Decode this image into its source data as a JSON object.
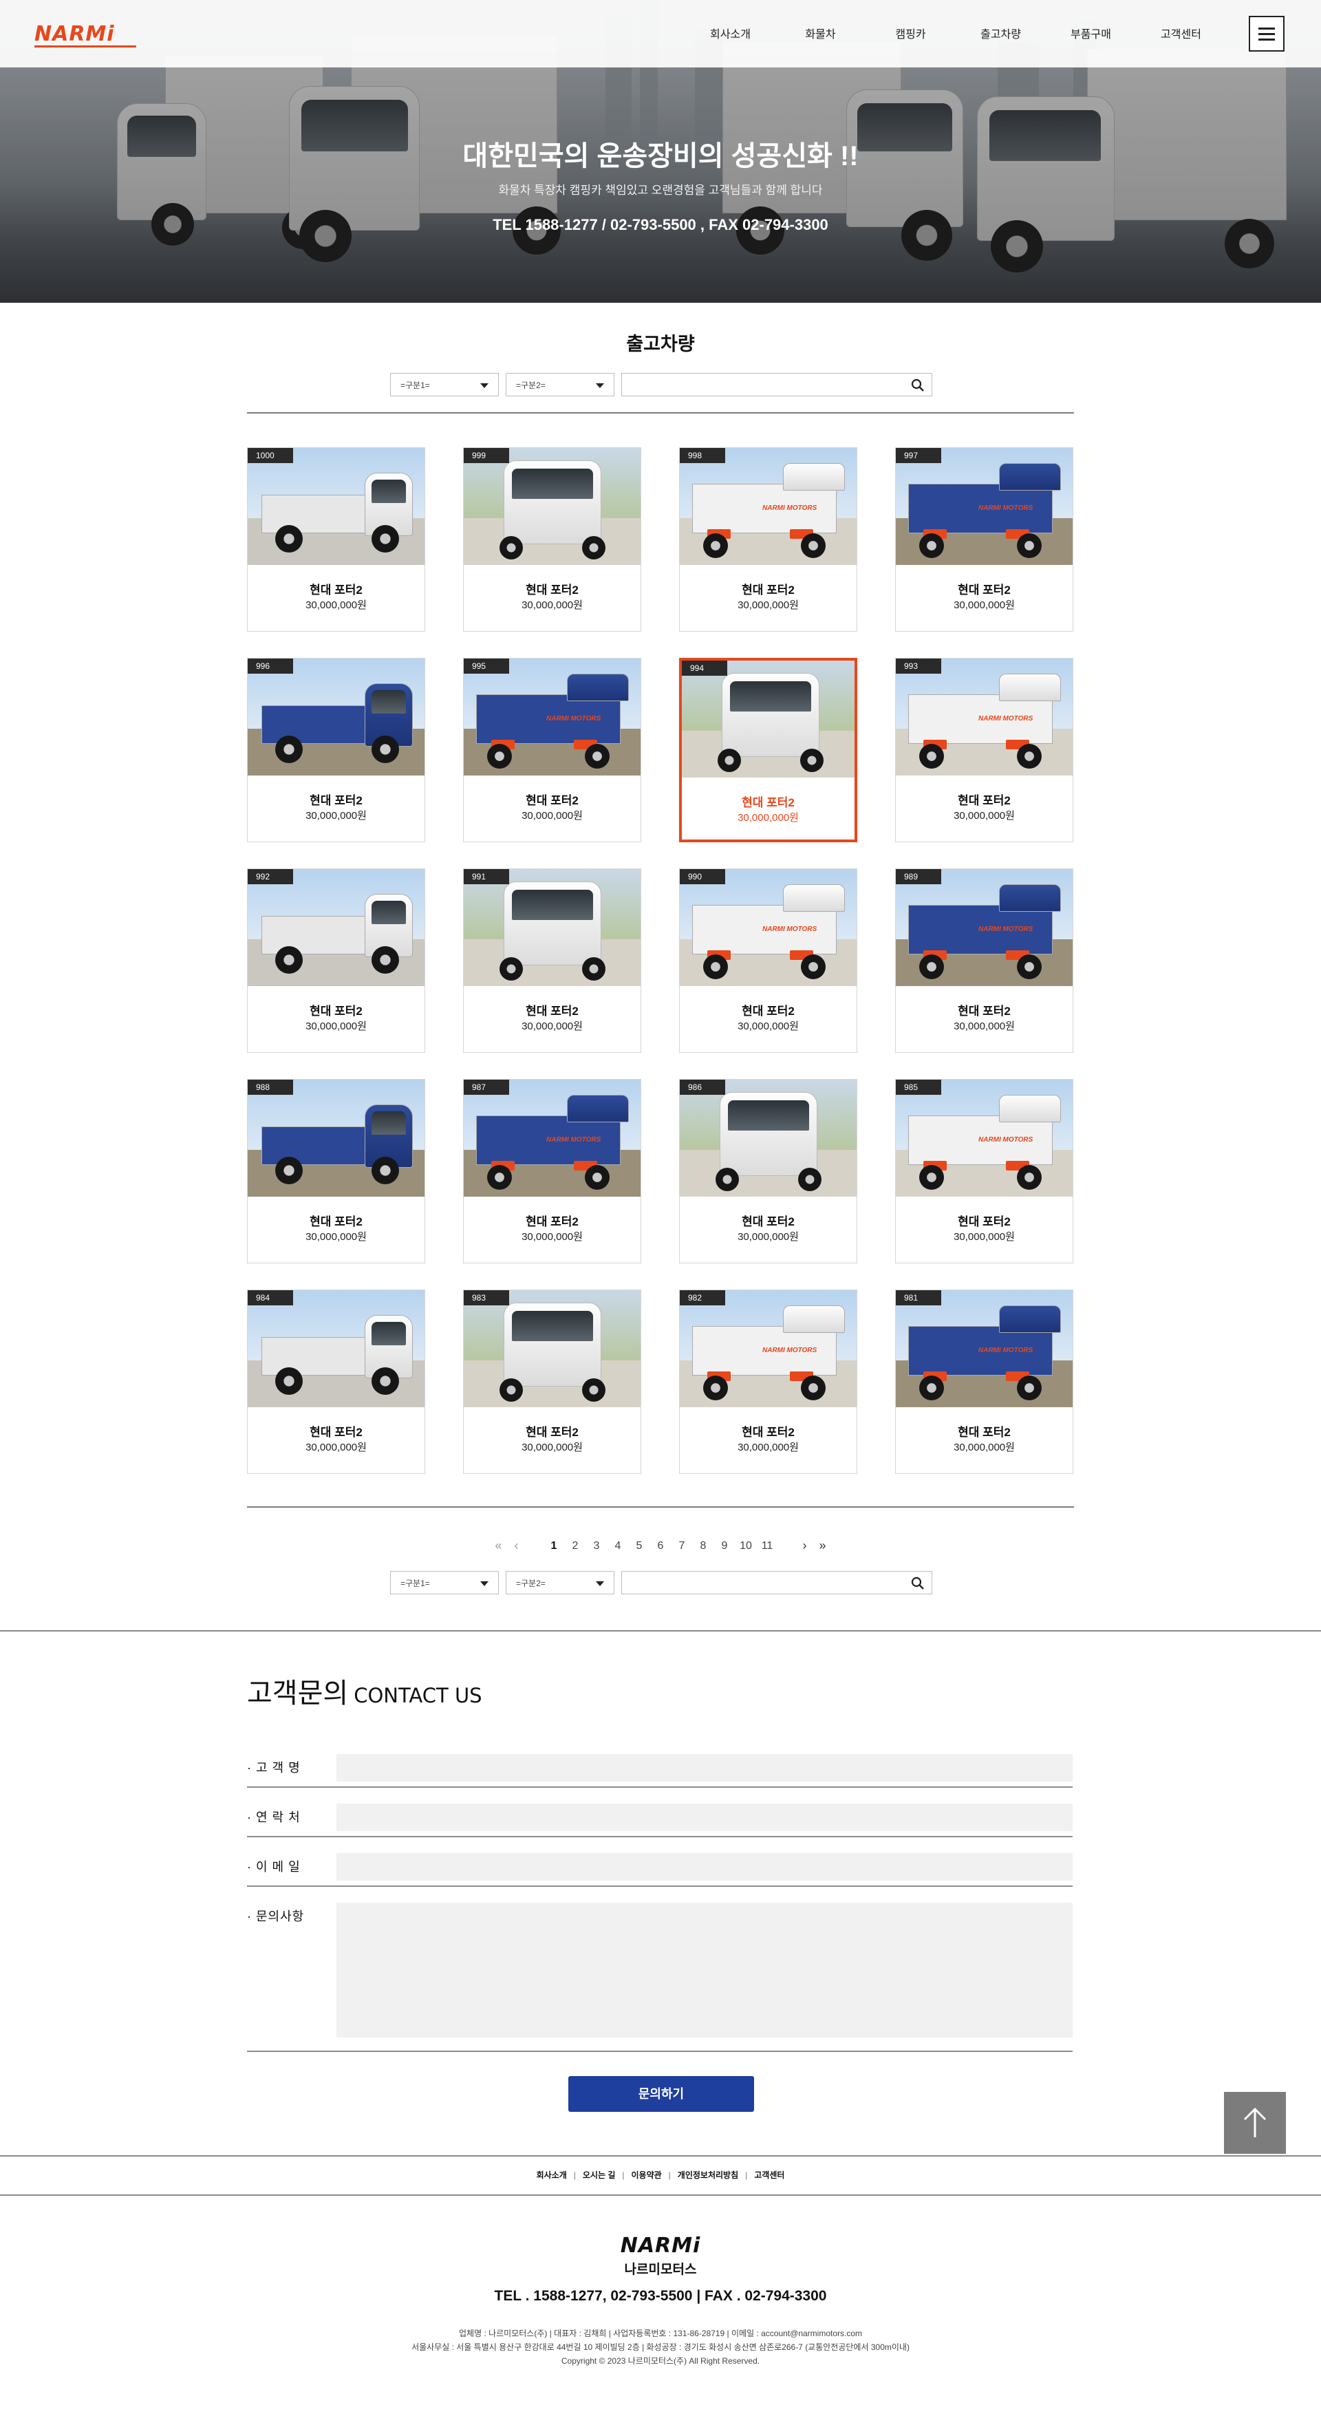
{
  "header": {
    "logo": "NARMi",
    "nav": [
      "회사소개",
      "화물차",
      "캠핑카",
      "출고차량",
      "부품구매",
      "고객센터"
    ]
  },
  "hero": {
    "title": "대한민국의 운송장비의 성공신화 !!",
    "subtitle": "화물차 특장차 캠핑카 책임있고 오랜경험을 고객님들과 함께 합니다",
    "tel": "TEL  1588-1277 / 02-793-5500 , FAX  02-794-3300"
  },
  "section": {
    "title": "출고차량",
    "filter1": "=구분1=",
    "filter2": "=구분2="
  },
  "cards": [
    {
      "no": "1000",
      "name": "현대 포터2",
      "price": "30,000,000원"
    },
    {
      "no": "999",
      "name": "현대 포터2",
      "price": "30,000,000원"
    },
    {
      "no": "998",
      "name": "현대 포터2",
      "price": "30,000,000원"
    },
    {
      "no": "997",
      "name": "현대 포터2",
      "price": "30,000,000원"
    },
    {
      "no": "996",
      "name": "현대 포터2",
      "price": "30,000,000원"
    },
    {
      "no": "995",
      "name": "현대 포터2",
      "price": "30,000,000원"
    },
    {
      "no": "994",
      "name": "현대 포터2",
      "price": "30,000,000원"
    },
    {
      "no": "993",
      "name": "현대 포터2",
      "price": "30,000,000원"
    },
    {
      "no": "992",
      "name": "현대 포터2",
      "price": "30,000,000원"
    },
    {
      "no": "991",
      "name": "현대 포터2",
      "price": "30,000,000원"
    },
    {
      "no": "990",
      "name": "현대 포터2",
      "price": "30,000,000원"
    },
    {
      "no": "989",
      "name": "현대 포터2",
      "price": "30,000,000원"
    },
    {
      "no": "988",
      "name": "현대 포터2",
      "price": "30,000,000원"
    },
    {
      "no": "987",
      "name": "현대 포터2",
      "price": "30,000,000원"
    },
    {
      "no": "986",
      "name": "현대 포터2",
      "price": "30,000,000원"
    },
    {
      "no": "985",
      "name": "현대 포터2",
      "price": "30,000,000원"
    },
    {
      "no": "984",
      "name": "현대 포터2",
      "price": "30,000,000원"
    },
    {
      "no": "983",
      "name": "현대 포터2",
      "price": "30,000,000원"
    },
    {
      "no": "982",
      "name": "현대 포터2",
      "price": "30,000,000원"
    },
    {
      "no": "981",
      "name": "현대 포터2",
      "price": "30,000,000원"
    }
  ],
  "active_card": "994",
  "truck_brand": "NARMI MOTORS",
  "pagination": {
    "first": "«",
    "prev": "‹",
    "pages": [
      "1",
      "2",
      "3",
      "4",
      "5",
      "6",
      "7",
      "8",
      "9",
      "10",
      "11"
    ],
    "current": "1",
    "next": "›",
    "last": "»"
  },
  "contact": {
    "title_ko": "고객문의",
    "title_en": "CONTACT US",
    "fields": [
      "· 고 객 명",
      "· 연 락 처",
      "· 이 메 일",
      "· 문의사항"
    ],
    "submit": "문의하기"
  },
  "footer": {
    "links": [
      "회사소개",
      "오시는 길",
      "이용약관",
      "개인정보처리방침",
      "고객센터"
    ],
    "logo_en": "NARMi",
    "logo_ko": "나르미모터스",
    "tel": "TEL . 1588-1277,  02-793-5500   |   FAX . 02-794-3300",
    "info1": "업체명 : 나르미모터스(주)   |   대표자 : 김채희   |   사업자등록번호 : 131-86-28719   |   이메일 : account@narmimotors.com",
    "info2": "서울사무실 : 서울 특별시 용산구 한강대로 44번길 10 제이빌딩 2층   |   화성공장 : 경기도 화성시 송산면 삼존로266-7 (교통안전공단에서 300m이내)",
    "copyright": "Copyright © 2023 나르미모터스(주) All Right Reserved."
  },
  "colors": {
    "accent": "#e8471c",
    "submit": "#1f3f9e",
    "top_button": "#7c7c7c"
  }
}
